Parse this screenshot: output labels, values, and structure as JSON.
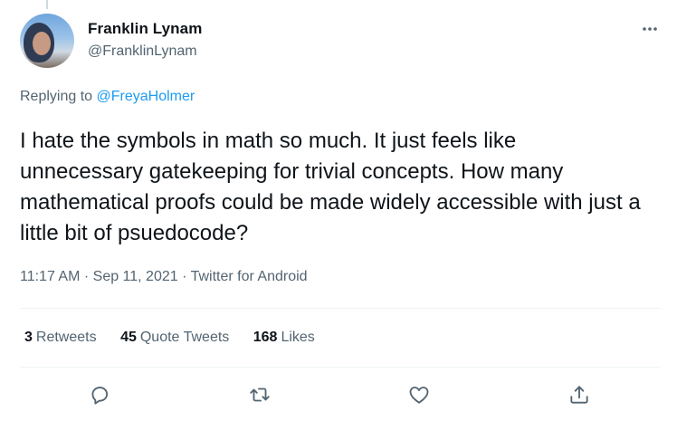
{
  "tweet": {
    "author": {
      "name": "Franklin Lynam",
      "handle": "@FranklinLynam"
    },
    "replying_to": {
      "prefix": "Replying to ",
      "mention": "@FreyaHolmer"
    },
    "text": "I hate the symbols in math so much. It just feels like unnecessary gatekeeping for trivial concepts. How many mathematical proofs could be made widely accessible with just a little bit of psuedocode?",
    "meta": {
      "time": "11:17 AM",
      "separator": " · ",
      "date": "Sep 11, 2021",
      "app": "Twitter for Android"
    },
    "stats": {
      "retweets": {
        "count": "3",
        "label": "Retweets"
      },
      "quote_tweets": {
        "count": "45",
        "label": "Quote Tweets"
      },
      "likes": {
        "count": "168",
        "label": "Likes"
      }
    },
    "actions": [
      "reply-icon",
      "retweet-icon",
      "like-icon",
      "share-icon"
    ]
  },
  "colors": {
    "text": "#0f1419",
    "secondary": "#536471",
    "accent": "#1d9bf0",
    "divider": "#eff3f4"
  }
}
